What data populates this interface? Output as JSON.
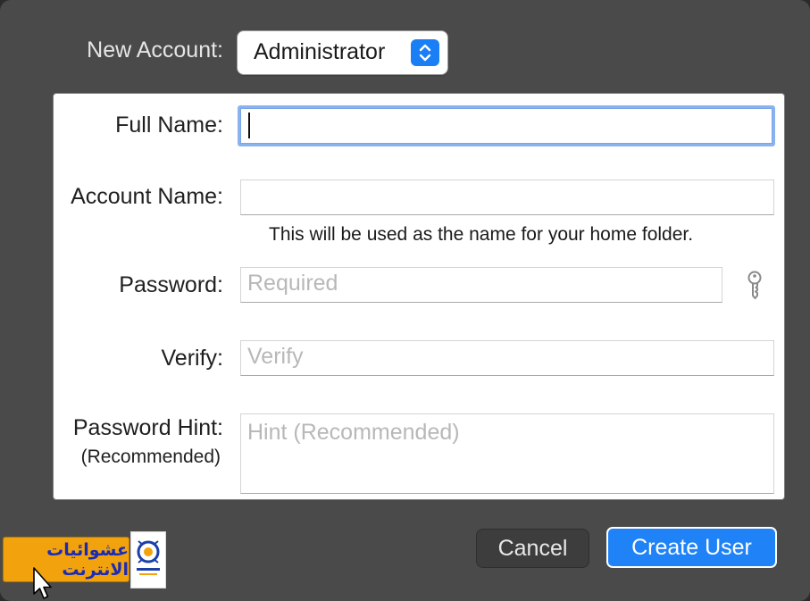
{
  "account_type": {
    "label": "New Account:",
    "selected": "Administrator"
  },
  "form": {
    "full_name": {
      "label": "Full Name:",
      "value": ""
    },
    "account_name": {
      "label": "Account Name:",
      "value": "",
      "note": "This will be used as the name for your home folder."
    },
    "password": {
      "label": "Password:",
      "placeholder": "Required"
    },
    "verify": {
      "label": "Verify:",
      "placeholder": "Verify"
    },
    "hint": {
      "label": "Password Hint:",
      "sublabel": "(Recommended)",
      "placeholder": "Hint (Recommended)"
    }
  },
  "buttons": {
    "cancel": "Cancel",
    "create": "Create User"
  },
  "watermark": {
    "text": "عشوائيات الانترنت"
  },
  "colors": {
    "accent": "#1f83f7",
    "sheet_bg": "#4a4a4a",
    "watermark_bg": "#f2a20c"
  },
  "icons": [
    "chevron-up-down-icon",
    "key-icon",
    "mouse-cursor-icon"
  ]
}
